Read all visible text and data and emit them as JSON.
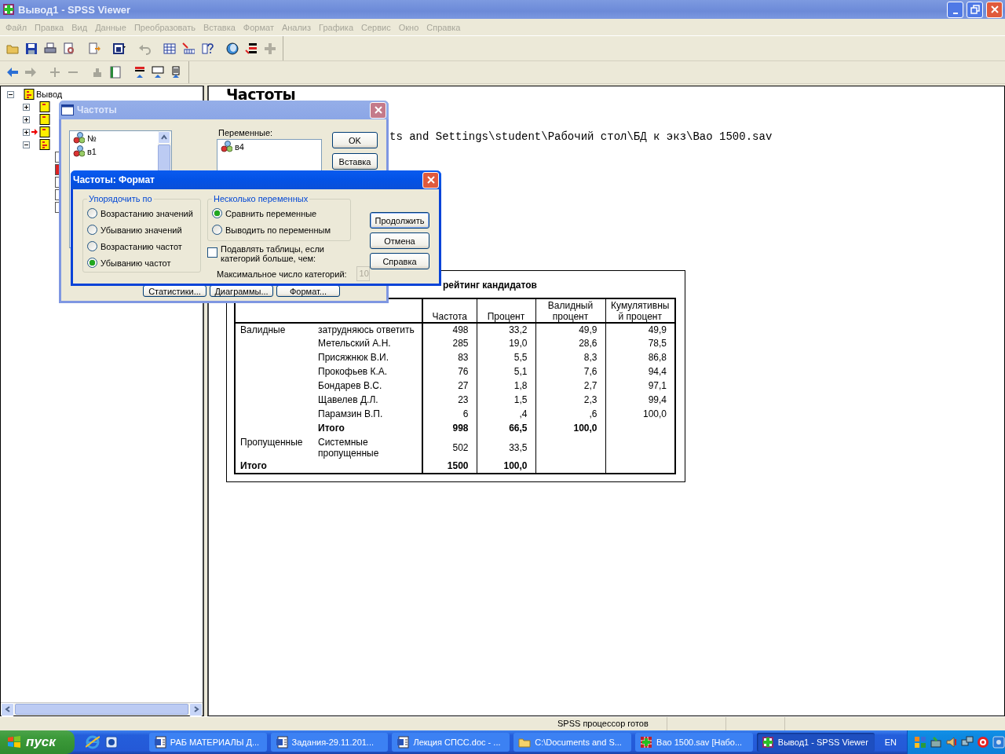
{
  "window": {
    "title": "Вывод1 - SPSS Viewer"
  },
  "menu": [
    {
      "label": "Файл",
      "disabled": true
    },
    {
      "label": "Правка",
      "disabled": true
    },
    {
      "label": "Вид",
      "disabled": true
    },
    {
      "label": "Данные",
      "disabled": true
    },
    {
      "label": "Преобразовать",
      "disabled": true
    },
    {
      "label": "Вставка",
      "disabled": true
    },
    {
      "label": "Формат",
      "disabled": true
    },
    {
      "label": "Анализ",
      "disabled": true
    },
    {
      "label": "Графика",
      "disabled": true
    },
    {
      "label": "Сервис",
      "disabled": true
    },
    {
      "label": "Окно",
      "disabled": true
    },
    {
      "label": "Справка",
      "disabled": true
    }
  ],
  "outline": {
    "items": [
      {
        "label": "Вывод",
        "expanded": true,
        "children": [
          {
            "expanded": false,
            "current": false
          },
          {
            "expanded": false,
            "current": false
          },
          {
            "expanded": false,
            "current": true
          },
          {
            "expanded": true,
            "current": false,
            "children": [
              {
                "kind": "page"
              },
              {
                "kind": "warning"
              },
              {
                "kind": "page"
              },
              {
                "kind": "page"
              },
              {
                "kind": "page"
              }
            ]
          }
        ]
      }
    ]
  },
  "output": {
    "heading": "Частоты",
    "path": "ts and Settings\\student\\Рабочий стол\\БД к экз\\Вао 1500.sav",
    "table": {
      "title": "рейтинг кандидатов",
      "columns": [
        "Частота",
        "Процент",
        "Валидный процент",
        "Кумулятивный процент"
      ],
      "groups": [
        {
          "label": "Валидные",
          "rows": [
            {
              "label": "затрудняюсь ответить",
              "total": false,
              "values": [
                "498",
                "33,2",
                "49,9",
                "49,9"
              ]
            },
            {
              "label": "Метельский А.Н.",
              "total": false,
              "values": [
                "285",
                "19,0",
                "28,6",
                "78,5"
              ]
            },
            {
              "label": "Присяжнюк В.И.",
              "total": false,
              "values": [
                "83",
                "5,5",
                "8,3",
                "86,8"
              ]
            },
            {
              "label": "Прокофьев К.А.",
              "total": false,
              "values": [
                "76",
                "5,1",
                "7,6",
                "94,4"
              ]
            },
            {
              "label": "Бондарев В.С.",
              "total": false,
              "values": [
                "27",
                "1,8",
                "2,7",
                "97,1"
              ]
            },
            {
              "label": "Щавелев Д.Л.",
              "total": false,
              "values": [
                "23",
                "1,5",
                "2,3",
                "99,4"
              ]
            },
            {
              "label": "Парамзин В.П.",
              "total": false,
              "values": [
                "6",
                ",4",
                ",6",
                "100,0"
              ]
            },
            {
              "label": "Итого",
              "total": true,
              "values": [
                "998",
                "66,5",
                "100,0"
              ]
            }
          ]
        },
        {
          "label": "Пропущенные",
          "rows": [
            {
              "label": "Системные пропущенные",
              "total": false,
              "values": [
                "502",
                "33,5"
              ]
            }
          ]
        }
      ],
      "total": {
        "label": "Итого",
        "values": [
          "1500",
          "100,0"
        ]
      }
    }
  },
  "frequencies_dialog": {
    "title": "Частоты",
    "source": [
      "№",
      "в1"
    ],
    "variables_label": "Переменные:",
    "variables": [
      "в4"
    ],
    "side_buttons": [
      "OK",
      "Вставка"
    ],
    "bottom_buttons": [
      "Статистики...",
      "Диаграммы...",
      "Формат..."
    ]
  },
  "format_dialog": {
    "title": "Частоты: Формат",
    "order": {
      "title": "Упорядочить по",
      "options": [
        {
          "label": "Возрастанию значений",
          "selected": false
        },
        {
          "label": "Убыванию значений",
          "selected": false
        },
        {
          "label": "Возрастанию частот",
          "selected": false
        },
        {
          "label": "Убыванию частот",
          "selected": true
        }
      ]
    },
    "multiple": {
      "title": "Несколько переменных",
      "options": [
        {
          "label": "Сравнить переменные",
          "selected": true
        },
        {
          "label": "Выводить по переменным",
          "selected": false
        }
      ]
    },
    "suppress": {
      "label": "Подавлять таблицы, если категорий больше, чем:",
      "checked": false
    },
    "max_categories": {
      "label": "Максимальное число категорий:",
      "value": "10",
      "disabled": true
    },
    "buttons": [
      {
        "label": "Продолжить",
        "default": true
      },
      {
        "label": "Отмена",
        "default": false
      },
      {
        "label": "Справка",
        "default": false
      }
    ]
  },
  "status_bar": "SPSS процессор готов",
  "taskbar": {
    "start": "пуск",
    "tasks": [
      {
        "kind": "word",
        "label": "РАБ МАТЕРИАЛЫ Д...",
        "selected": false
      },
      {
        "kind": "word",
        "label": "Задания-29.11.201...",
        "selected": false
      },
      {
        "kind": "word",
        "label": "Лекция СПСС.doc - ...",
        "selected": false
      },
      {
        "kind": "folder",
        "label": "C:\\Documents and S...",
        "selected": false
      },
      {
        "kind": "data",
        "label": "Вао 1500.sav [Набо...",
        "selected": false
      },
      {
        "kind": "viewer",
        "label": "Вывод1 - SPSS Viewer",
        "selected": true
      }
    ],
    "language": "EN"
  }
}
